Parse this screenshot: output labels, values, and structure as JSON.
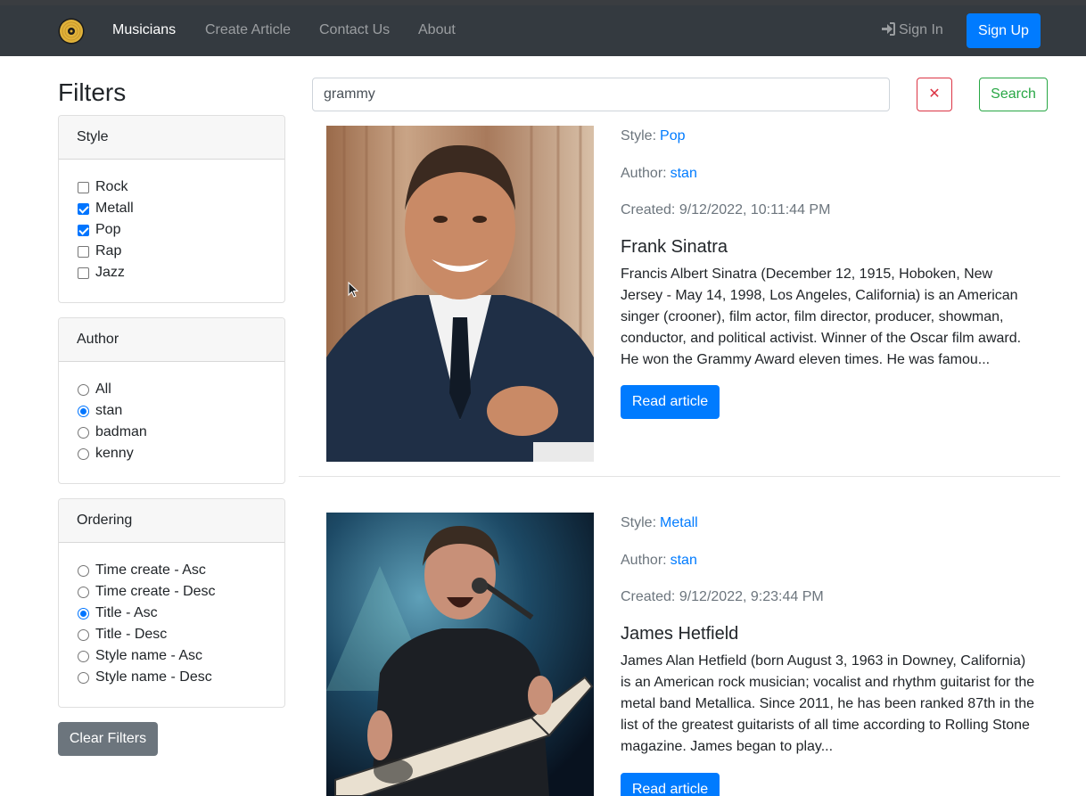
{
  "nav": {
    "brand_icon": "vinyl-record-icon",
    "links": [
      "Musicians",
      "Create Article",
      "Contact Us",
      "About"
    ],
    "signin": "Sign In",
    "signin_icon": "sign-in-icon",
    "signup": "Sign Up"
  },
  "filters": {
    "title": "Filters",
    "style": {
      "header": "Style",
      "options": [
        {
          "label": "Rock",
          "checked": false
        },
        {
          "label": "Metall",
          "checked": true
        },
        {
          "label": "Pop",
          "checked": true
        },
        {
          "label": "Rap",
          "checked": false
        },
        {
          "label": "Jazz",
          "checked": false
        }
      ]
    },
    "author": {
      "header": "Author",
      "options": [
        {
          "label": "All",
          "selected": false
        },
        {
          "label": "stan",
          "selected": true
        },
        {
          "label": "badman",
          "selected": false
        },
        {
          "label": "kenny",
          "selected": false
        }
      ]
    },
    "ordering": {
      "header": "Ordering",
      "options": [
        {
          "label": "Time create - Asc",
          "selected": false
        },
        {
          "label": "Time create - Desc",
          "selected": false
        },
        {
          "label": "Title - Asc",
          "selected": true
        },
        {
          "label": "Title - Desc",
          "selected": false
        },
        {
          "label": "Style name - Asc",
          "selected": false
        },
        {
          "label": "Style name - Desc",
          "selected": false
        }
      ]
    },
    "clear": "Clear Filters"
  },
  "search": {
    "value": "grammy",
    "clear_label": "✕",
    "button": "Search"
  },
  "articles": [
    {
      "style_label": "Style:",
      "style": "Pop",
      "author_label": "Author:",
      "author": "stan",
      "created": "Created: 9/12/2022, 10:11:44 PM",
      "title": "Frank Sinatra",
      "text": "Francis Albert Sinatra (December 12, 1915, Hoboken, New Jersey - May 14, 1998, Los Angeles, California) is an American singer (crooner), film actor, film director, producer, showman, conductor, and political activist. Winner of the Oscar film award. He won the Grammy Award eleven times. He was famou...",
      "button": "Read article"
    },
    {
      "style_label": "Style:",
      "style": "Metall",
      "author_label": "Author:",
      "author": "stan",
      "created": "Created: 9/12/2022, 9:23:44 PM",
      "title": "James Hetfield",
      "text": "James Alan Hetfield (born August 3, 1963 in Downey, California) is an American rock musician; vocalist and rhythm guitarist for the metal band Metallica. Since 2011, he has been ranked 87th in the list of the greatest guitarists of all time according to Rolling Stone magazine. James began to play...",
      "button": "Read article"
    }
  ],
  "colors": {
    "navbar": "#343a40",
    "primary": "#007bff",
    "danger": "#dc3545",
    "success": "#28a745",
    "secondary": "#6c757d"
  }
}
